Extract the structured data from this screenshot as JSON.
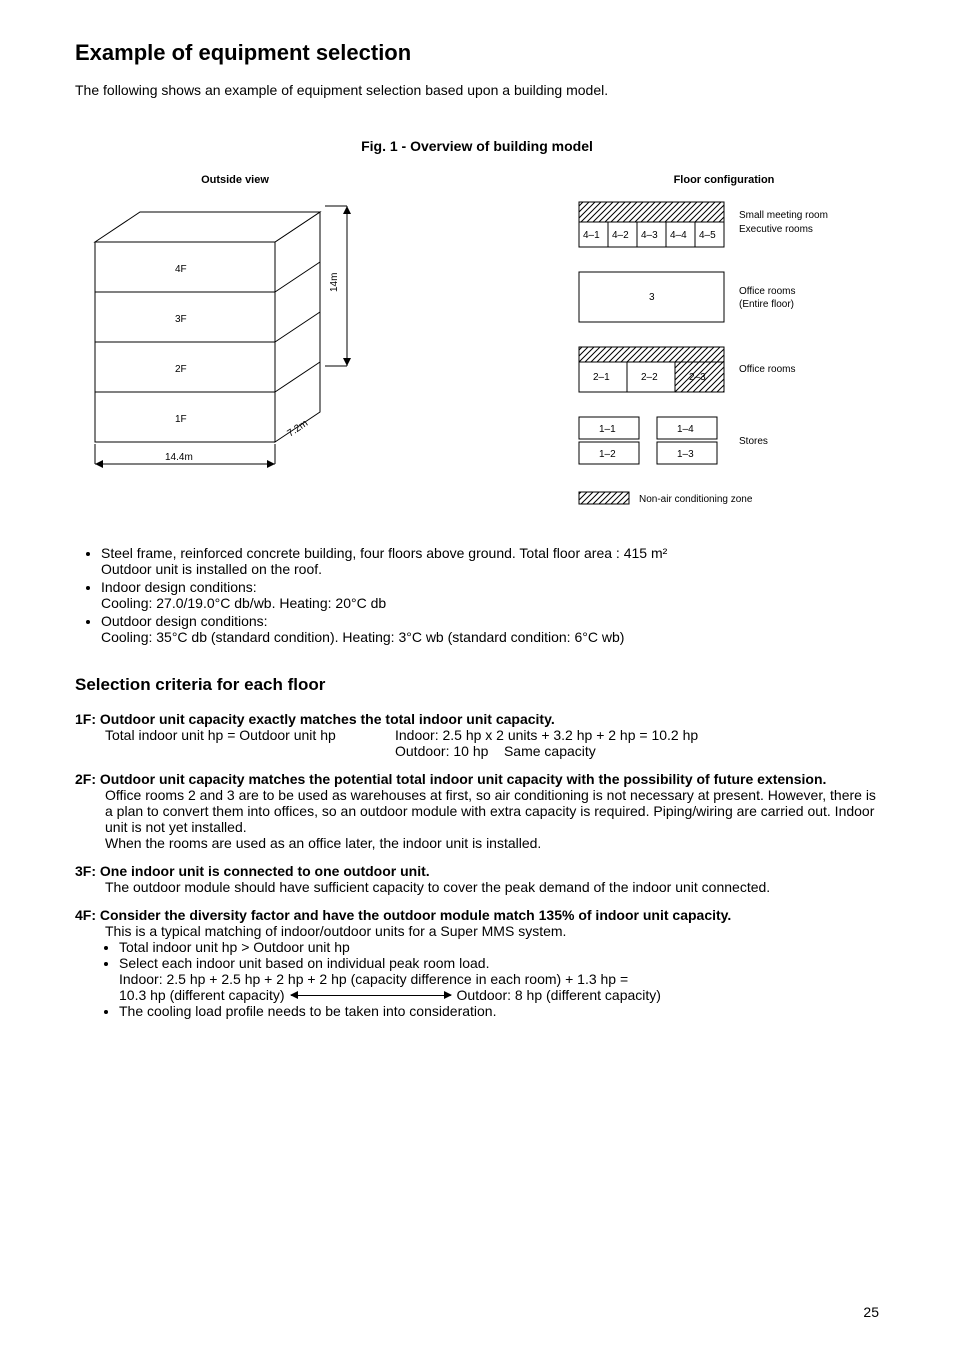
{
  "title": "Example of equipment selection",
  "intro": "The following shows an example of equipment selection based upon a building model.",
  "figTitle": "Fig. 1 - Overview of building model",
  "diagramTitles": {
    "outside": "Outside view",
    "floor": "Floor configuration"
  },
  "outside": {
    "floors": [
      "4F",
      "3F",
      "2F",
      "1F"
    ],
    "height": "14m",
    "width": "14.4m",
    "depth": "7.2m"
  },
  "floorConfig": {
    "f4": {
      "cells": [
        "4–1",
        "4–2",
        "4–3",
        "4–4",
        "4–5"
      ],
      "label1": "Small meeting room",
      "label2": "Executive rooms"
    },
    "f3": {
      "cell": "3",
      "label1": "Office rooms",
      "label2": "(Entire floor)"
    },
    "f2": {
      "cells": [
        "2–1",
        "2–2",
        "2–3"
      ],
      "label": "Office rooms"
    },
    "f1": {
      "cells": [
        "1–1",
        "1–2",
        "1–3",
        "1–4"
      ],
      "label": "Stores"
    },
    "legend": "Non-air conditioning zone"
  },
  "buildingBullets": [
    "Steel frame, reinforced concrete building, four floors above ground.  Total floor area : 415 m²\nOutdoor unit is installed on the roof.",
    "Indoor design conditions:\nCooling: 27.0/19.0°C db/wb. Heating: 20°C db",
    "Outdoor design conditions:\nCooling: 35°C db (standard condition). Heating: 3°C wb (standard condition: 6°C wb)"
  ],
  "criteriaTitle": "Selection criteria for each floor",
  "f1": {
    "head": "1F:  Outdoor unit capacity exactly matches the total indoor unit capacity.",
    "line1": "Total indoor unit hp = Outdoor unit hp",
    "line2": "Indoor: 2.5 hp x 2 units + 3.2 hp + 2 hp = 10.2 hp",
    "line3": "Outdoor: 10 hp    Same capacity"
  },
  "f2": {
    "head": "2F:  Outdoor unit capacity matches the potential total indoor unit capacity with the possibility of future extension.",
    "body": "Office rooms 2 and 3 are to be used as warehouses at first, so air conditioning is not necessary at present. However, there is a plan to convert them into offices, so an outdoor module with extra capacity is required. Piping/wiring are carried out. Indoor unit is not yet installed.\nWhen the rooms are used as an office later, the indoor unit is installed."
  },
  "f3": {
    "head": "3F:  One indoor unit is connected to one outdoor unit.",
    "body": "The  outdoor module should have sufficient capacity to cover the peak demand of the indoor unit connected."
  },
  "f4": {
    "head": "4F:  Consider the diversity factor and have the outdoor module match 135% of indoor unit capacity.",
    "intro": "This is a typical matching of indoor/outdoor units for a Super MMS system.",
    "b1": "Total indoor unit hp > Outdoor unit hp",
    "b2a": "Select each indoor unit based on individual peak room load.",
    "b2b": "Indoor: 2.5 hp + 2.5 hp + 2 hp + 2 hp (capacity difference in each room) + 1.3 hp =",
    "b2c": "10.3 hp (different capacity)",
    "b2d": "Outdoor: 8 hp (different capacity)",
    "b3": "The cooling load profile needs to be taken into consideration."
  },
  "pageNum": "25"
}
